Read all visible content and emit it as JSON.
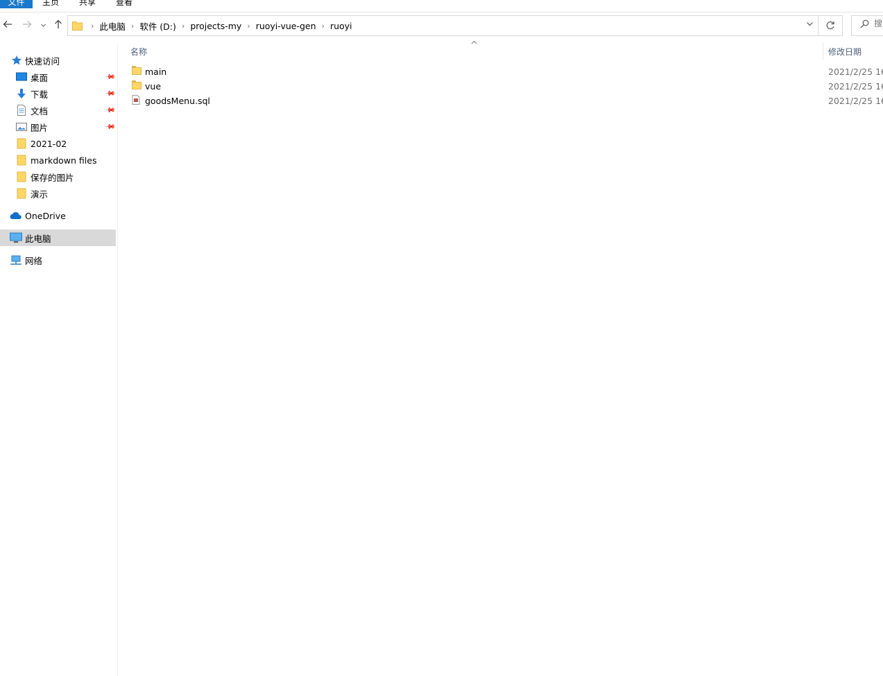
{
  "ribbon": {
    "tabs": [
      "文件",
      "主页",
      "共享",
      "查看"
    ]
  },
  "address": {
    "crumbs": [
      "此电脑",
      "软件 (D:)",
      "projects-my",
      "ruoyi-vue-gen",
      "ruoyi"
    ]
  },
  "search": {
    "placeholder": "搜"
  },
  "sidebar": {
    "quick_access": "快速访问",
    "items": [
      {
        "label": "桌面",
        "icon": "desktop-icon",
        "pinned": true
      },
      {
        "label": "下载",
        "icon": "download-icon",
        "pinned": true
      },
      {
        "label": "文档",
        "icon": "document-icon",
        "pinned": true
      },
      {
        "label": "图片",
        "icon": "picture-icon",
        "pinned": true
      },
      {
        "label": "2021-02",
        "icon": "folder-icon",
        "pinned": false
      },
      {
        "label": "markdown files",
        "icon": "folder-icon",
        "pinned": false
      },
      {
        "label": "保存的图片",
        "icon": "folder-icon",
        "pinned": false
      },
      {
        "label": "演示",
        "icon": "folder-icon",
        "pinned": false
      }
    ],
    "onedrive": "OneDrive",
    "this_pc": "此电脑",
    "network": "网络"
  },
  "columns": {
    "name": "名称",
    "date": "修改日期"
  },
  "files": [
    {
      "name": "main",
      "type": "folder",
      "date": "2021/2/25 16:"
    },
    {
      "name": "vue",
      "type": "folder",
      "date": "2021/2/25 16:"
    },
    {
      "name": "goodsMenu.sql",
      "type": "sql-file",
      "date": "2021/2/25 16:"
    }
  ],
  "colors": {
    "file_tab": "#1979ca",
    "selected_nav": "#d9d9d9",
    "folder": "#ffd766"
  }
}
